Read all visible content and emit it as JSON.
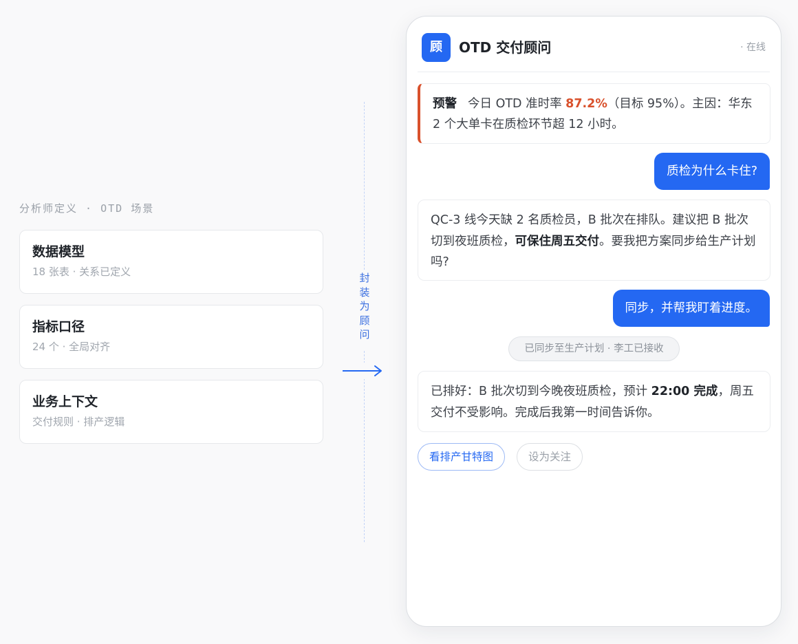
{
  "left": {
    "header": "分析师定义 · OTD 场景",
    "cards": [
      {
        "title": "数据模型",
        "subtitle": "18 张表 · 关系已定义"
      },
      {
        "title": "指标口径",
        "subtitle": "24 个 · 全局对齐"
      },
      {
        "title": "业务上下文",
        "subtitle": "交付规则 · 排产逻辑"
      }
    ]
  },
  "connector": {
    "label_chars": [
      "封",
      "装",
      "为",
      "顾",
      "问"
    ],
    "arrow_icon": "arrow-right-icon"
  },
  "chat": {
    "avatar_text": "顾",
    "title": "OTD 交付顾问",
    "status": "· 在线",
    "alert": {
      "tag": "预警",
      "text_before": "今日 OTD 准时率 ",
      "highlight": "87.2%",
      "text_after": "（目标 95%）。主因：华东 2 个大单卡在质检环节超 12 小时。",
      "accent_color": "#d9512c"
    },
    "messages": {
      "user_q1": "质检为什么卡住?",
      "bot_a1": {
        "part1": "QC-3 线今天缺 2 名质检员，B 批次在排队。建议把 B 批次切到夜班质检，",
        "bold": "可保住周五交付",
        "part2": "。要我把方案同步给生产计划吗?"
      },
      "user_q2": "同步，并帮我盯着进度。",
      "system_notice": "已同步至生产计划 · 李工已接收",
      "bot_a2": {
        "part1": "已排好：B 批次切到今晚夜班质检，预计 ",
        "bold": "22:00 完成",
        "part2": "，周五交付不受影响。完成后我第一时间告诉你。"
      }
    },
    "actions": {
      "primary": "看排产甘特图",
      "secondary": "设为关注"
    },
    "brand_color": "#2468f2"
  }
}
